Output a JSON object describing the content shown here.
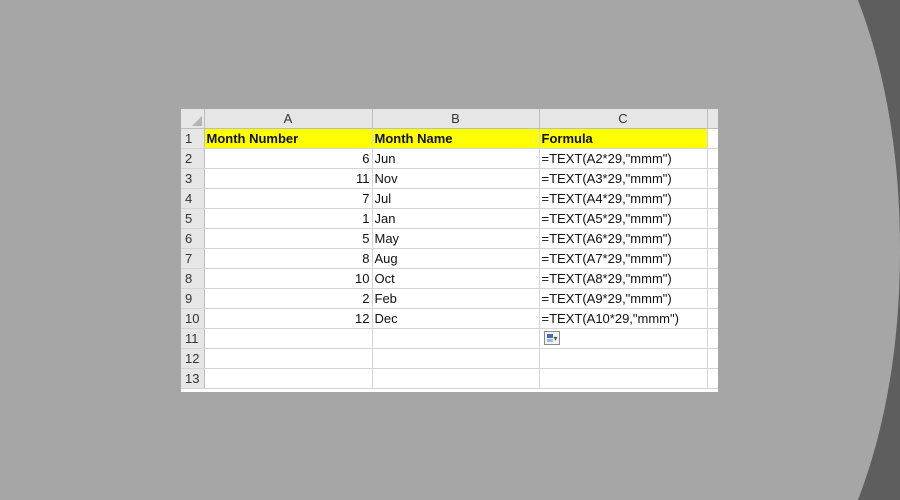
{
  "columns": [
    "A",
    "B",
    "C"
  ],
  "headers": {
    "row": "1",
    "a": "Month Number",
    "b": "Month Name",
    "c": "Formula"
  },
  "rows": [
    {
      "row": "2",
      "a": "6",
      "b": "Jun",
      "c": "=TEXT(A2*29,\"mmm\")"
    },
    {
      "row": "3",
      "a": "11",
      "b": "Nov",
      "c": "=TEXT(A3*29,\"mmm\")"
    },
    {
      "row": "4",
      "a": "7",
      "b": "Jul",
      "c": "=TEXT(A4*29,\"mmm\")"
    },
    {
      "row": "5",
      "a": "1",
      "b": "Jan",
      "c": "=TEXT(A5*29,\"mmm\")"
    },
    {
      "row": "6",
      "a": "5",
      "b": "May",
      "c": "=TEXT(A6*29,\"mmm\")"
    },
    {
      "row": "7",
      "a": "8",
      "b": "Aug",
      "c": "=TEXT(A7*29,\"mmm\")"
    },
    {
      "row": "8",
      "a": "10",
      "b": "Oct",
      "c": "=TEXT(A8*29,\"mmm\")"
    },
    {
      "row": "9",
      "a": "2",
      "b": "Feb",
      "c": "=TEXT(A9*29,\"mmm\")"
    },
    {
      "row": "10",
      "a": "12",
      "b": "Dec",
      "c": "=TEXT(A10*29,\"mmm\")"
    }
  ],
  "empty_rows": [
    "11",
    "12",
    "13"
  ],
  "colors": {
    "header_fill": "#ffff00",
    "background": "#a6a6a6"
  },
  "icons": {
    "paste_options": "paste-options-icon"
  }
}
